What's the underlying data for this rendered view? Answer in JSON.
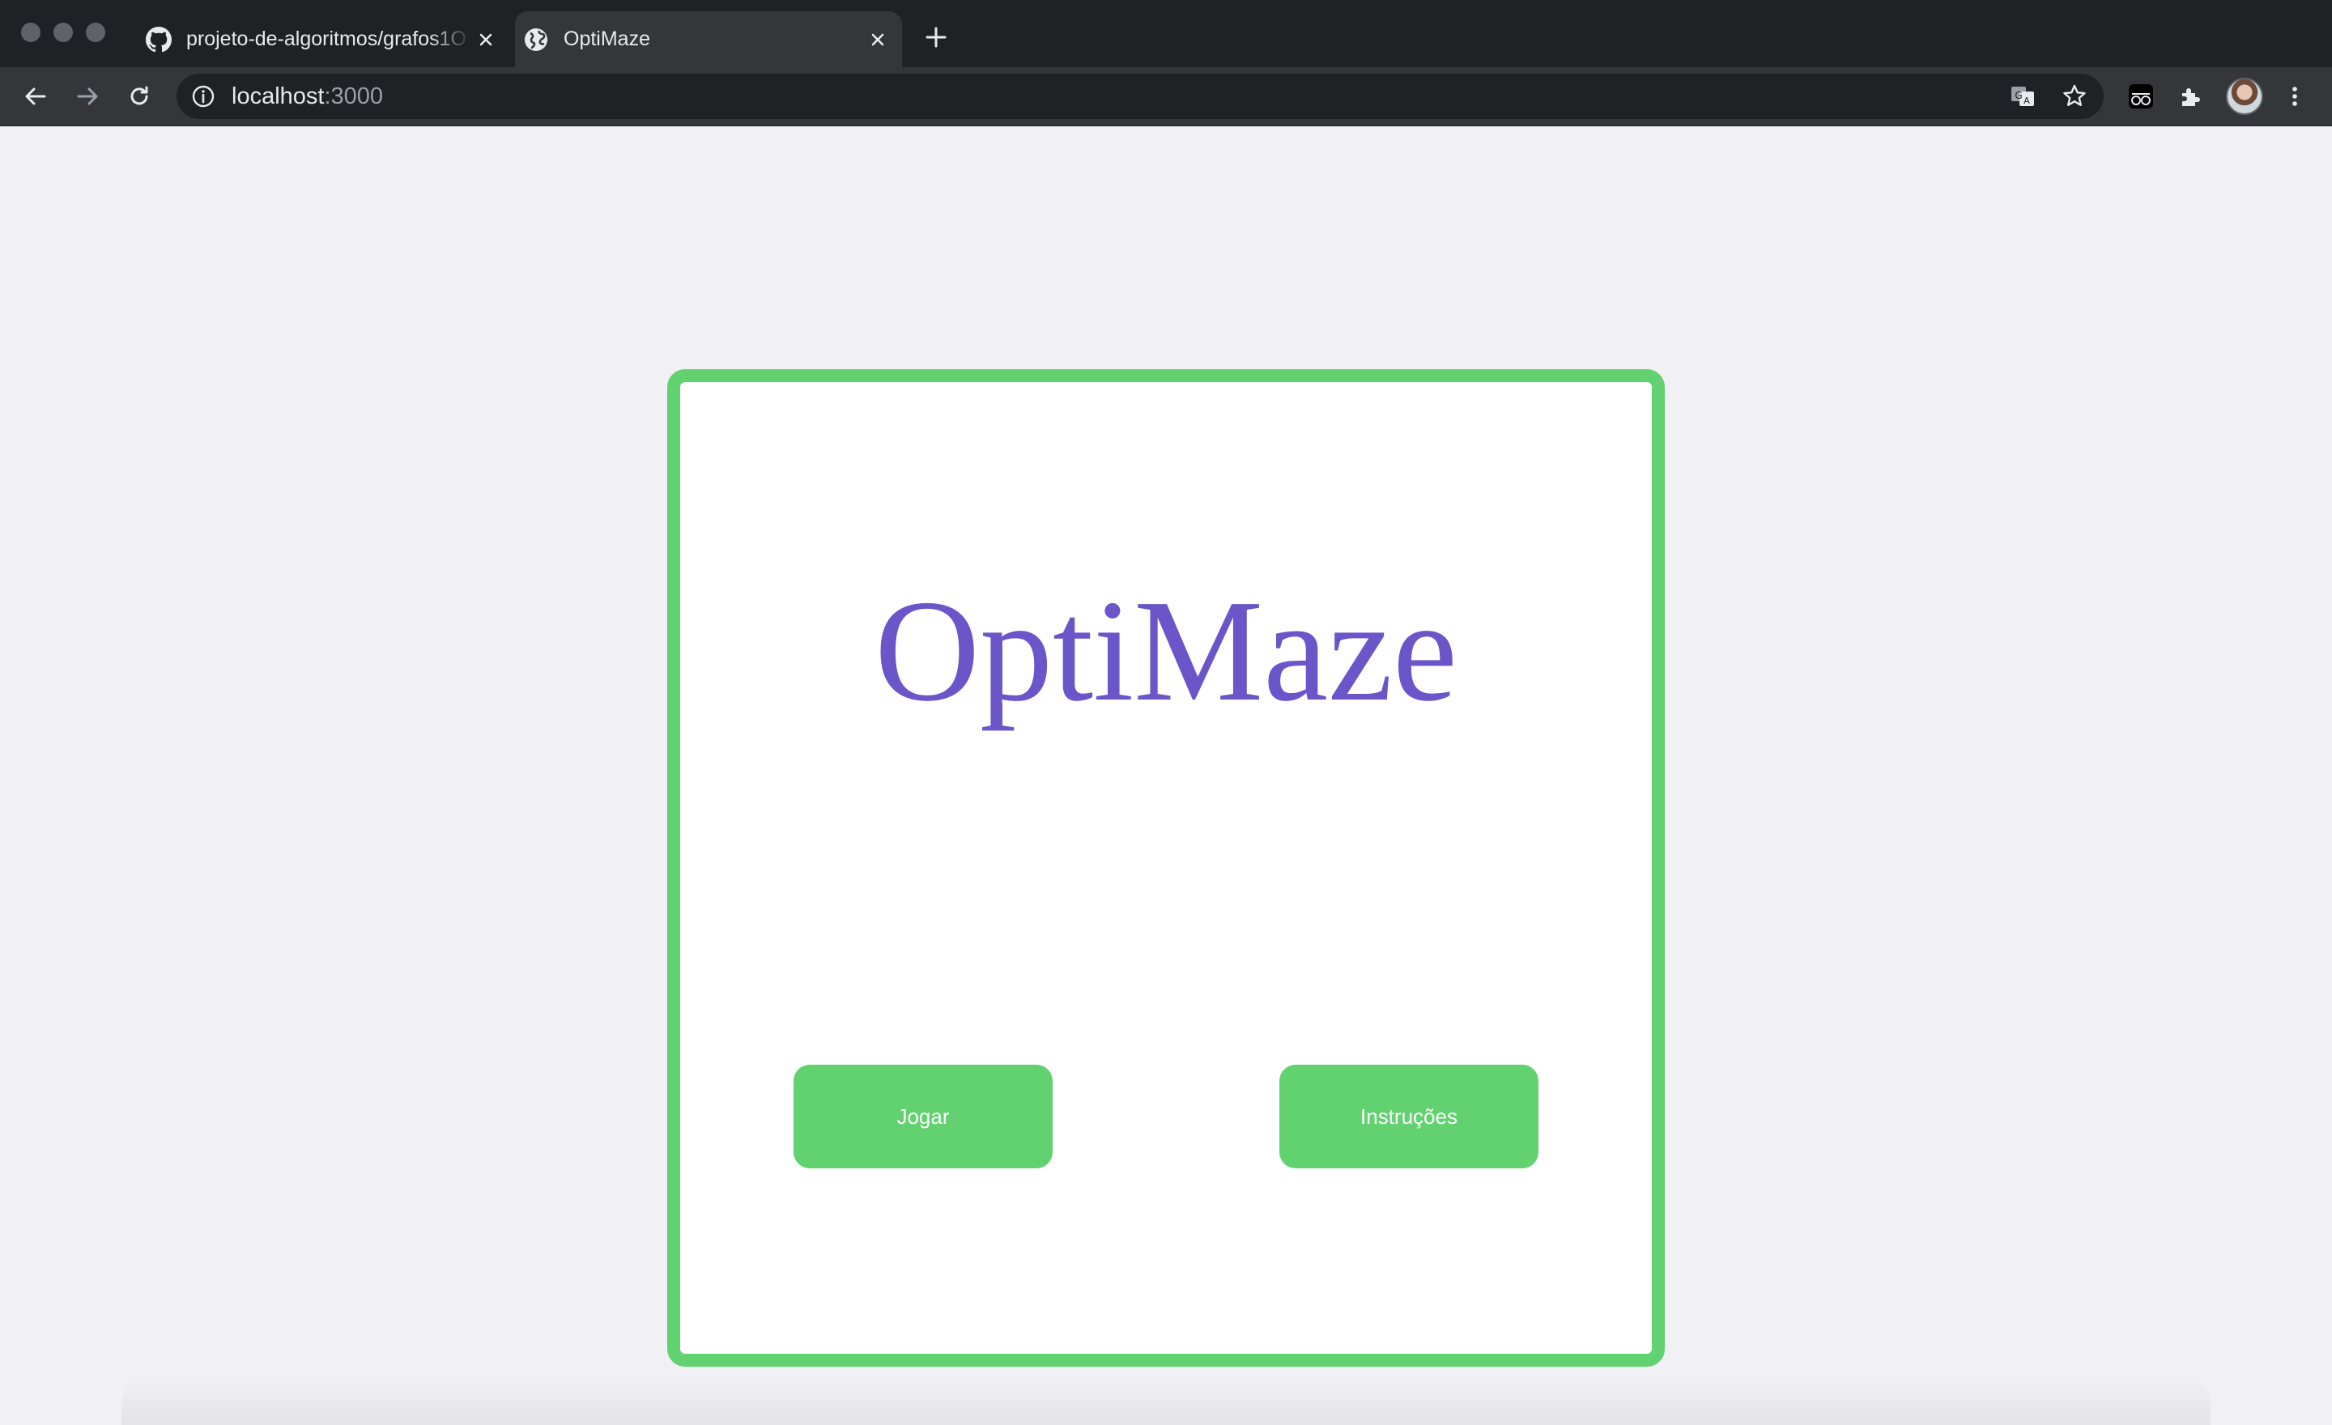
{
  "browser": {
    "tabs": [
      {
        "title": "projeto-de-algoritmos/grafos1O",
        "favicon": "github-icon",
        "active": false
      },
      {
        "title": "OptiMaze",
        "favicon": "globe-icon",
        "active": true
      }
    ],
    "address": {
      "host": "localhost",
      "port": ":3000"
    },
    "colors": {
      "chrome_dark": "#202124",
      "chrome_toolbar": "#35363a"
    }
  },
  "page": {
    "title": "OptiMaze",
    "buttons": {
      "play": "Jogar",
      "instructions": "Instruções"
    },
    "colors": {
      "accent_green": "#62d16f",
      "title_purple": "#6a55c9",
      "background": "#f0f0f5"
    }
  }
}
